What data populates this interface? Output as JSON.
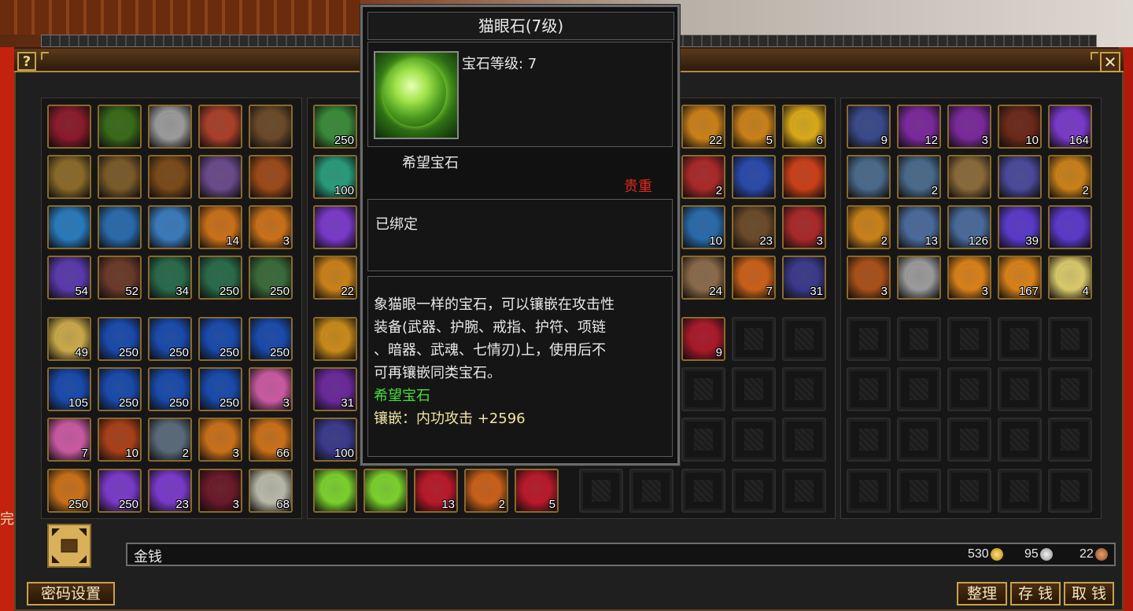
{
  "tooltip": {
    "title": "猫眼石(7级)",
    "gem_level": "宝石等级: 7",
    "category": "希望宝石",
    "rarity": "贵重",
    "bound": "已绑定",
    "desc_lines": [
      "象猫眼一样的宝石，可以镶嵌在攻击性",
      "装备(武器、护腕、戒指、护符、项链",
      "、暗器、武魂、七情刃)上，使用后不",
      "可再镶嵌同类宝石。"
    ],
    "set_name": "希望宝石",
    "inlay": "镶嵌：内功攻击 +2596"
  },
  "bottom": {
    "gold_label": "金钱",
    "gold": "530",
    "silver": "95",
    "copper": "22",
    "password_button": "密码设置",
    "sort_button": "整理",
    "deposit_button": "存 钱",
    "withdraw_button": "取 钱"
  },
  "side_text": "完",
  "colors": {
    "slot_border": "#8a6a2c",
    "rarity": "#e02a1a",
    "set_name": "#44e03a",
    "inlay": "#f2e6a0"
  },
  "panel1": {
    "counts": [
      "",
      "",
      "",
      "",
      "",
      "",
      "",
      "",
      "",
      "",
      "",
      "",
      "",
      "14",
      "3",
      "54",
      "52",
      "34",
      "250",
      "250",
      "49",
      "250",
      "250",
      "250",
      "250",
      "105",
      "250",
      "250",
      "250",
      "3",
      "7",
      "10",
      "2",
      "3",
      "66",
      "250",
      "250",
      "23",
      "3",
      "68"
    ],
    "icons": [
      "#8a1c2c",
      "#3a6a1a",
      "#9a9a9a",
      "#a8402a",
      "#6a4a2a",
      "#8a6a2a",
      "#7a5a2a",
      "#7a4a1a",
      "#6a4a8a",
      "#9a4a1a",
      "#2a7aba",
      "#2a6aaa",
      "#3a7aba",
      "#c8701a",
      "#c8701a",
      "#5a3aaa",
      "#6a3a2a",
      "#2a6a4a",
      "#2a6a4a",
      "#3a6a3a",
      "#c8a84a",
      "#1a4aaa",
      "#1a4aaa",
      "#1a4aaa",
      "#1a4aaa",
      "#1a4aaa",
      "#1a4aaa",
      "#1a4aaa",
      "#1a4aaa",
      "#c85aa0",
      "#c85aa0",
      "#a8401a",
      "#5a6a7a",
      "#c8701a",
      "#c8701a",
      "#c8701a",
      "#7a3ac8",
      "#7a3ac8",
      "#6a1a2a",
      "#b8b8a8"
    ]
  },
  "panel2_col": {
    "counts": [
      "250",
      "100",
      "",
      "22",
      "",
      "31",
      "100"
    ],
    "icons": [
      "#3a8a3a",
      "#2a9a7a",
      "#7a3ac8",
      "#c8801a",
      "#c88a1a",
      "#6a2a9a",
      "#3a3a8a"
    ]
  },
  "panel2_bottom": {
    "counts": [
      "",
      "",
      "13",
      "2",
      "5"
    ],
    "icons": [
      "#7bcf2e",
      "#7bcf2e",
      "#b81a2a",
      "#c8601a",
      "#b81a2a"
    ]
  },
  "panel2_right": {
    "counts": [
      "22",
      "5",
      "6",
      "2",
      "",
      "",
      "10",
      "23",
      "3",
      "24",
      "7",
      "31",
      "9",
      "",
      ""
    ],
    "icons": [
      "#c8801a",
      "#c8801a",
      "#d8a81a",
      "#a82a2a",
      "#2a4aaa",
      "#c8401a",
      "#2a6aaa",
      "#6a4a2a",
      "#a82a2a",
      "#8a6a4a",
      "#c8601a",
      "#3a3a8a",
      "#a81a2a",
      "",
      ""
    ]
  },
  "panel3": {
    "counts": [
      "9",
      "12",
      "3",
      "10",
      "164",
      "",
      "2",
      "",
      "",
      "2",
      "2",
      "13",
      "126",
      "39",
      "",
      "3",
      "",
      "3",
      "167",
      "4"
    ],
    "icons": [
      "#3a4a8a",
      "#7a2a9a",
      "#7a2a9a",
      "#6a2a1a",
      "#7a3ac8",
      "#4a6a8a",
      "#4a6a8a",
      "#8a6a3a",
      "#4a4a9a",
      "#c8801a",
      "#c8801a",
      "#4a6a9a",
      "#4a6a9a",
      "#5a3ac8",
      "#5a3ac8",
      "#a8501a",
      "#9a9a9a",
      "#d8801a",
      "#d8801a",
      "#d8c86a"
    ]
  }
}
